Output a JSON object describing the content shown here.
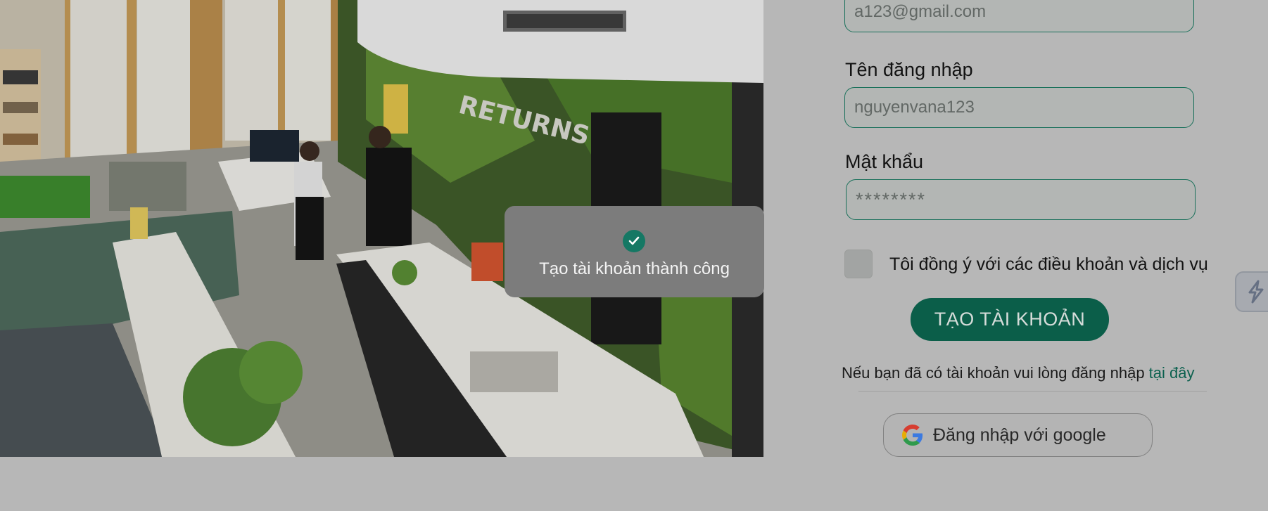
{
  "form": {
    "email_value": "a123@gmail.com",
    "username_label": "Tên đăng nhập",
    "username_placeholder": "nguyenvana123",
    "password_label": "Mật khẩu",
    "password_placeholder": "********",
    "agree_label": "Tôi đồng ý với các điều khoản và dịch vụ",
    "create_button": "TẠO TÀI KHOẢN",
    "login_hint": "Nếu bạn đã có tài khoản vui lòng đăng nhập ",
    "login_link": "tại đây",
    "google_button": "Đăng nhập với google"
  },
  "toast": {
    "message": "Tạo tài khoản thành công",
    "icon": "check-icon"
  },
  "photo": {
    "sign_text": "RETURNS"
  },
  "colors": {
    "accent": "#0d6650",
    "toast_bg": "#7c7c7c",
    "page_bg": "#c7c7c7"
  }
}
